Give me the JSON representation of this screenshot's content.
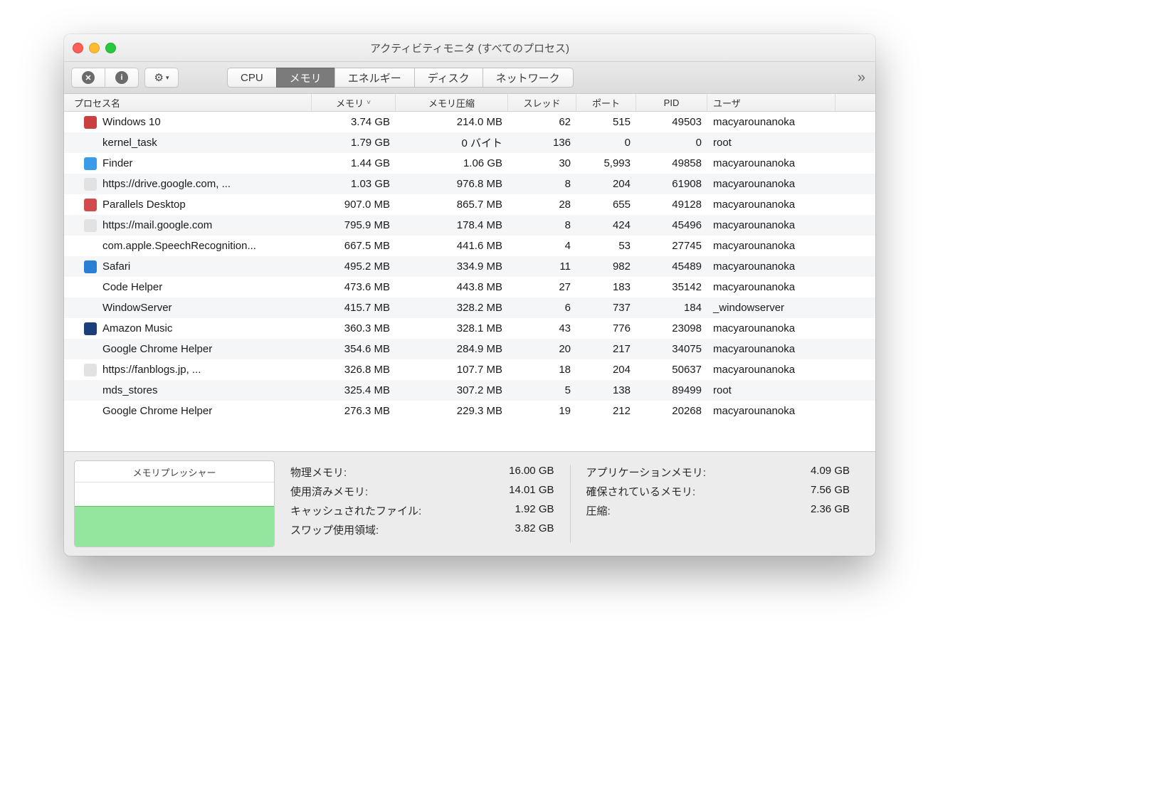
{
  "window": {
    "title": "アクティビティモニタ (すべてのプロセス)"
  },
  "toolbar": {
    "stop": "✕",
    "info": "i",
    "gear": "⚙",
    "tabs": {
      "cpu": "CPU",
      "memory": "メモリ",
      "energy": "エネルギー",
      "disk": "ディスク",
      "network": "ネットワーク",
      "active": "memory"
    },
    "overflow": "»"
  },
  "columns": {
    "name": "プロセス名",
    "memory": "メモリ",
    "compressed": "メモリ圧縮",
    "threads": "スレッド",
    "ports": "ポート",
    "pid": "PID",
    "user": "ユーザ",
    "sort_indicator": "˅"
  },
  "processes": [
    {
      "icon": "#c94040",
      "name": "Windows 10",
      "memory": "3.74 GB",
      "compressed": "214.0 MB",
      "threads": "62",
      "ports": "515",
      "pid": "49503",
      "user": "macyarounanoka"
    },
    {
      "icon": "",
      "name": "kernel_task",
      "memory": "1.79 GB",
      "compressed": "0 バイト",
      "threads": "136",
      "ports": "0",
      "pid": "0",
      "user": "root"
    },
    {
      "icon": "#3a9be8",
      "name": "Finder",
      "memory": "1.44 GB",
      "compressed": "1.06 GB",
      "threads": "30",
      "ports": "5,993",
      "pid": "49858",
      "user": "macyarounanoka"
    },
    {
      "icon": "#e2e2e2",
      "name": "https://drive.google.com, ...",
      "memory": "1.03 GB",
      "compressed": "976.8 MB",
      "threads": "8",
      "ports": "204",
      "pid": "61908",
      "user": "macyarounanoka"
    },
    {
      "icon": "#d04b4b",
      "name": "Parallels Desktop",
      "memory": "907.0 MB",
      "compressed": "865.7 MB",
      "threads": "28",
      "ports": "655",
      "pid": "49128",
      "user": "macyarounanoka"
    },
    {
      "icon": "#e2e2e2",
      "name": "https://mail.google.com",
      "memory": "795.9 MB",
      "compressed": "178.4 MB",
      "threads": "8",
      "ports": "424",
      "pid": "45496",
      "user": "macyarounanoka"
    },
    {
      "icon": "",
      "name": "com.apple.SpeechRecognition...",
      "memory": "667.5 MB",
      "compressed": "441.6 MB",
      "threads": "4",
      "ports": "53",
      "pid": "27745",
      "user": "macyarounanoka"
    },
    {
      "icon": "#2a7fd5",
      "name": "Safari",
      "memory": "495.2 MB",
      "compressed": "334.9 MB",
      "threads": "11",
      "ports": "982",
      "pid": "45489",
      "user": "macyarounanoka"
    },
    {
      "icon": "",
      "name": "Code Helper",
      "memory": "473.6 MB",
      "compressed": "443.8 MB",
      "threads": "27",
      "ports": "183",
      "pid": "35142",
      "user": "macyarounanoka"
    },
    {
      "icon": "",
      "name": "WindowServer",
      "memory": "415.7 MB",
      "compressed": "328.2 MB",
      "threads": "6",
      "ports": "737",
      "pid": "184",
      "user": "_windowserver"
    },
    {
      "icon": "#1b3f7a",
      "name": "Amazon Music",
      "memory": "360.3 MB",
      "compressed": "328.1 MB",
      "threads": "43",
      "ports": "776",
      "pid": "23098",
      "user": "macyarounanoka"
    },
    {
      "icon": "",
      "name": "Google Chrome Helper",
      "memory": "354.6 MB",
      "compressed": "284.9 MB",
      "threads": "20",
      "ports": "217",
      "pid": "34075",
      "user": "macyarounanoka"
    },
    {
      "icon": "#e2e2e2",
      "name": "https://fanblogs.jp, ...",
      "memory": "326.8 MB",
      "compressed": "107.7 MB",
      "threads": "18",
      "ports": "204",
      "pid": "50637",
      "user": "macyarounanoka"
    },
    {
      "icon": "",
      "name": "mds_stores",
      "memory": "325.4 MB",
      "compressed": "307.2 MB",
      "threads": "5",
      "ports": "138",
      "pid": "89499",
      "user": "root"
    },
    {
      "icon": "",
      "name": "Google Chrome Helper",
      "memory": "276.3 MB",
      "compressed": "229.3 MB",
      "threads": "19",
      "ports": "212",
      "pid": "20268",
      "user": "macyarounanoka"
    }
  ],
  "summary": {
    "graph_title": "メモリプレッシャー",
    "left": [
      {
        "k": "物理メモリ:",
        "v": "16.00 GB"
      },
      {
        "k": "使用済みメモリ:",
        "v": "14.01 GB"
      },
      {
        "k": "キャッシュされたファイル:",
        "v": "1.92 GB"
      },
      {
        "k": "スワップ使用領域:",
        "v": "3.82 GB"
      }
    ],
    "right": [
      {
        "k": "アプリケーションメモリ:",
        "v": "4.09 GB"
      },
      {
        "k": "確保されているメモリ:",
        "v": "7.56 GB"
      },
      {
        "k": "圧縮:",
        "v": "2.36 GB"
      }
    ]
  }
}
